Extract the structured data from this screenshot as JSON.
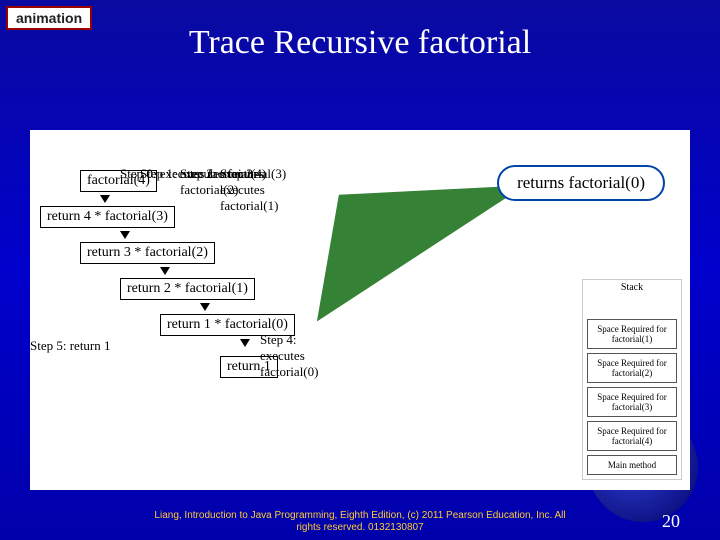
{
  "badge": "animation",
  "title": "Trace Recursive factorial",
  "callout": "returns factorial(0)",
  "diagram": {
    "root": "factorial(4)",
    "steps": [
      {
        "label": "Step 0: executes factorial(4)",
        "node": "return 4 * factorial(3)"
      },
      {
        "label": "Step 1: executes factorial(3)",
        "node": "return 3 * factorial(2)"
      },
      {
        "label": "Step 2: executes factorial(2)",
        "node": "return 2 * factorial(1)"
      },
      {
        "label": "Step 3: executes factorial(1)",
        "node": "return 1 * factorial(0)"
      },
      {
        "label": "Step 4: executes factorial(0)",
        "node": "return 1"
      }
    ],
    "step5": "Step 5: return 1"
  },
  "stack": {
    "title": "Stack",
    "items": [
      "Space Required for factorial(1)",
      "Space Required for factorial(2)",
      "Space Required for factorial(3)",
      "Space Required for factorial(4)",
      "Main method"
    ]
  },
  "footer": {
    "line1": "Liang, Introduction to Java Programming, Eighth Edition, (c) 2011 Pearson Education, Inc. All",
    "line2": "rights reserved. 0132130807"
  },
  "page": "20"
}
